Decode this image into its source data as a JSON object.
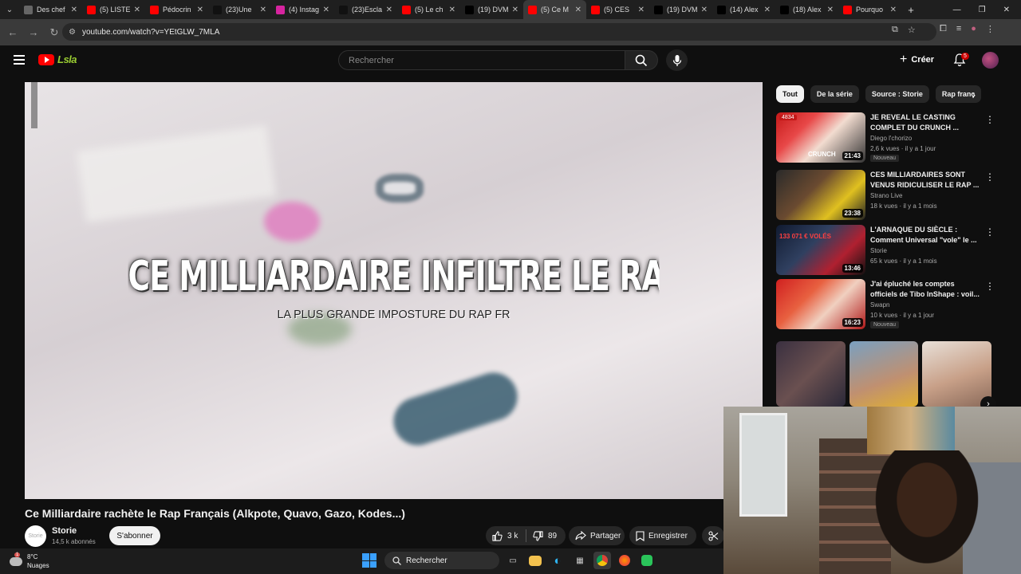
{
  "browser": {
    "tabs": [
      {
        "title": "Des chef",
        "color": "#666666"
      },
      {
        "title": "(5) LISTE",
        "color": "#ff0000"
      },
      {
        "title": "Pédocrin",
        "color": "#ff0000"
      },
      {
        "title": "(23)Une",
        "color": "#111111"
      },
      {
        "title": "(4) Instag",
        "color": "#d6249f"
      },
      {
        "title": "(23)Escla",
        "color": "#111111"
      },
      {
        "title": "(5) Le ch",
        "color": "#ff0000"
      },
      {
        "title": "(19) DVM",
        "color": "#000000"
      },
      {
        "title": "(5) Ce M",
        "color": "#ff0000",
        "active": true
      },
      {
        "title": "(5) CES",
        "color": "#ff0000"
      },
      {
        "title": "(19) DVM",
        "color": "#000000"
      },
      {
        "title": "(14) Alex",
        "color": "#000000"
      },
      {
        "title": "(18) Alex",
        "color": "#000000"
      },
      {
        "title": "Pourquo",
        "color": "#ff0000"
      }
    ],
    "url": "youtube.com/watch?v=YEtGLW_7MLA"
  },
  "header": {
    "logo_text": "Lsla",
    "search_placeholder": "Rechercher",
    "create_label": "Créer",
    "notif_count": "5"
  },
  "video": {
    "overlay_title": "CE MILLIARDAIRE INFILTRE LE RAP FR",
    "overlay_subtitle": "LA PLUS GRANDE IMPOSTURE DU RAP FR",
    "title": "Ce Milliardaire rachète le Rap Français (Alkpote, Quavo, Gazo, Kodes...)",
    "channel": "Storie",
    "subscribers": "14,5 k abonnés",
    "channel_avatar_text": "Storie",
    "subscribe_label": "S'abonner",
    "likes": "3 k",
    "dislikes": "89",
    "share_label": "Partager",
    "save_label": "Enregistrer"
  },
  "sidebar": {
    "chips": [
      {
        "label": "Tout",
        "active": true
      },
      {
        "label": "De la série"
      },
      {
        "label": "Source : Storie"
      },
      {
        "label": "Rap franç"
      }
    ],
    "recommendations": [
      {
        "title": "JE REVEAL LE CASTING COMPLET DU CRUNCH ...",
        "channel": "Diego l'chorizo",
        "meta": "2,6 k vues · il y a 1 jour",
        "duration": "21:43",
        "badge": "Nouveau",
        "thumb_text": "CRUNCH",
        "thumb_views": "4834"
      },
      {
        "title": "CES MILLIARDAIRES SONT VENUS RIDICULISER LE RAP ...",
        "channel": "Strano Live",
        "meta": "18 k vues · il y a 1 mois",
        "duration": "23:38",
        "badge": ""
      },
      {
        "title": "L'ARNAQUE DU SIÈCLE : Comment Universal \"vole\" le ...",
        "channel": "Storie",
        "meta": "65 k vues · il y a 1 mois",
        "duration": "13:46",
        "badge": "",
        "thumb_text": "133 071 € VOLÉS"
      },
      {
        "title": "J'ai épluché les comptes officiels de Tibo InShape : voil...",
        "channel": "Swapn",
        "meta": "10 k vues · il y a 1 jour",
        "duration": "16:23",
        "badge": "Nouveau"
      }
    ]
  },
  "taskbar": {
    "weather_temp": "8°C",
    "weather_desc": "Nuages",
    "weather_badge": "1",
    "search_label": "Rechercher"
  }
}
